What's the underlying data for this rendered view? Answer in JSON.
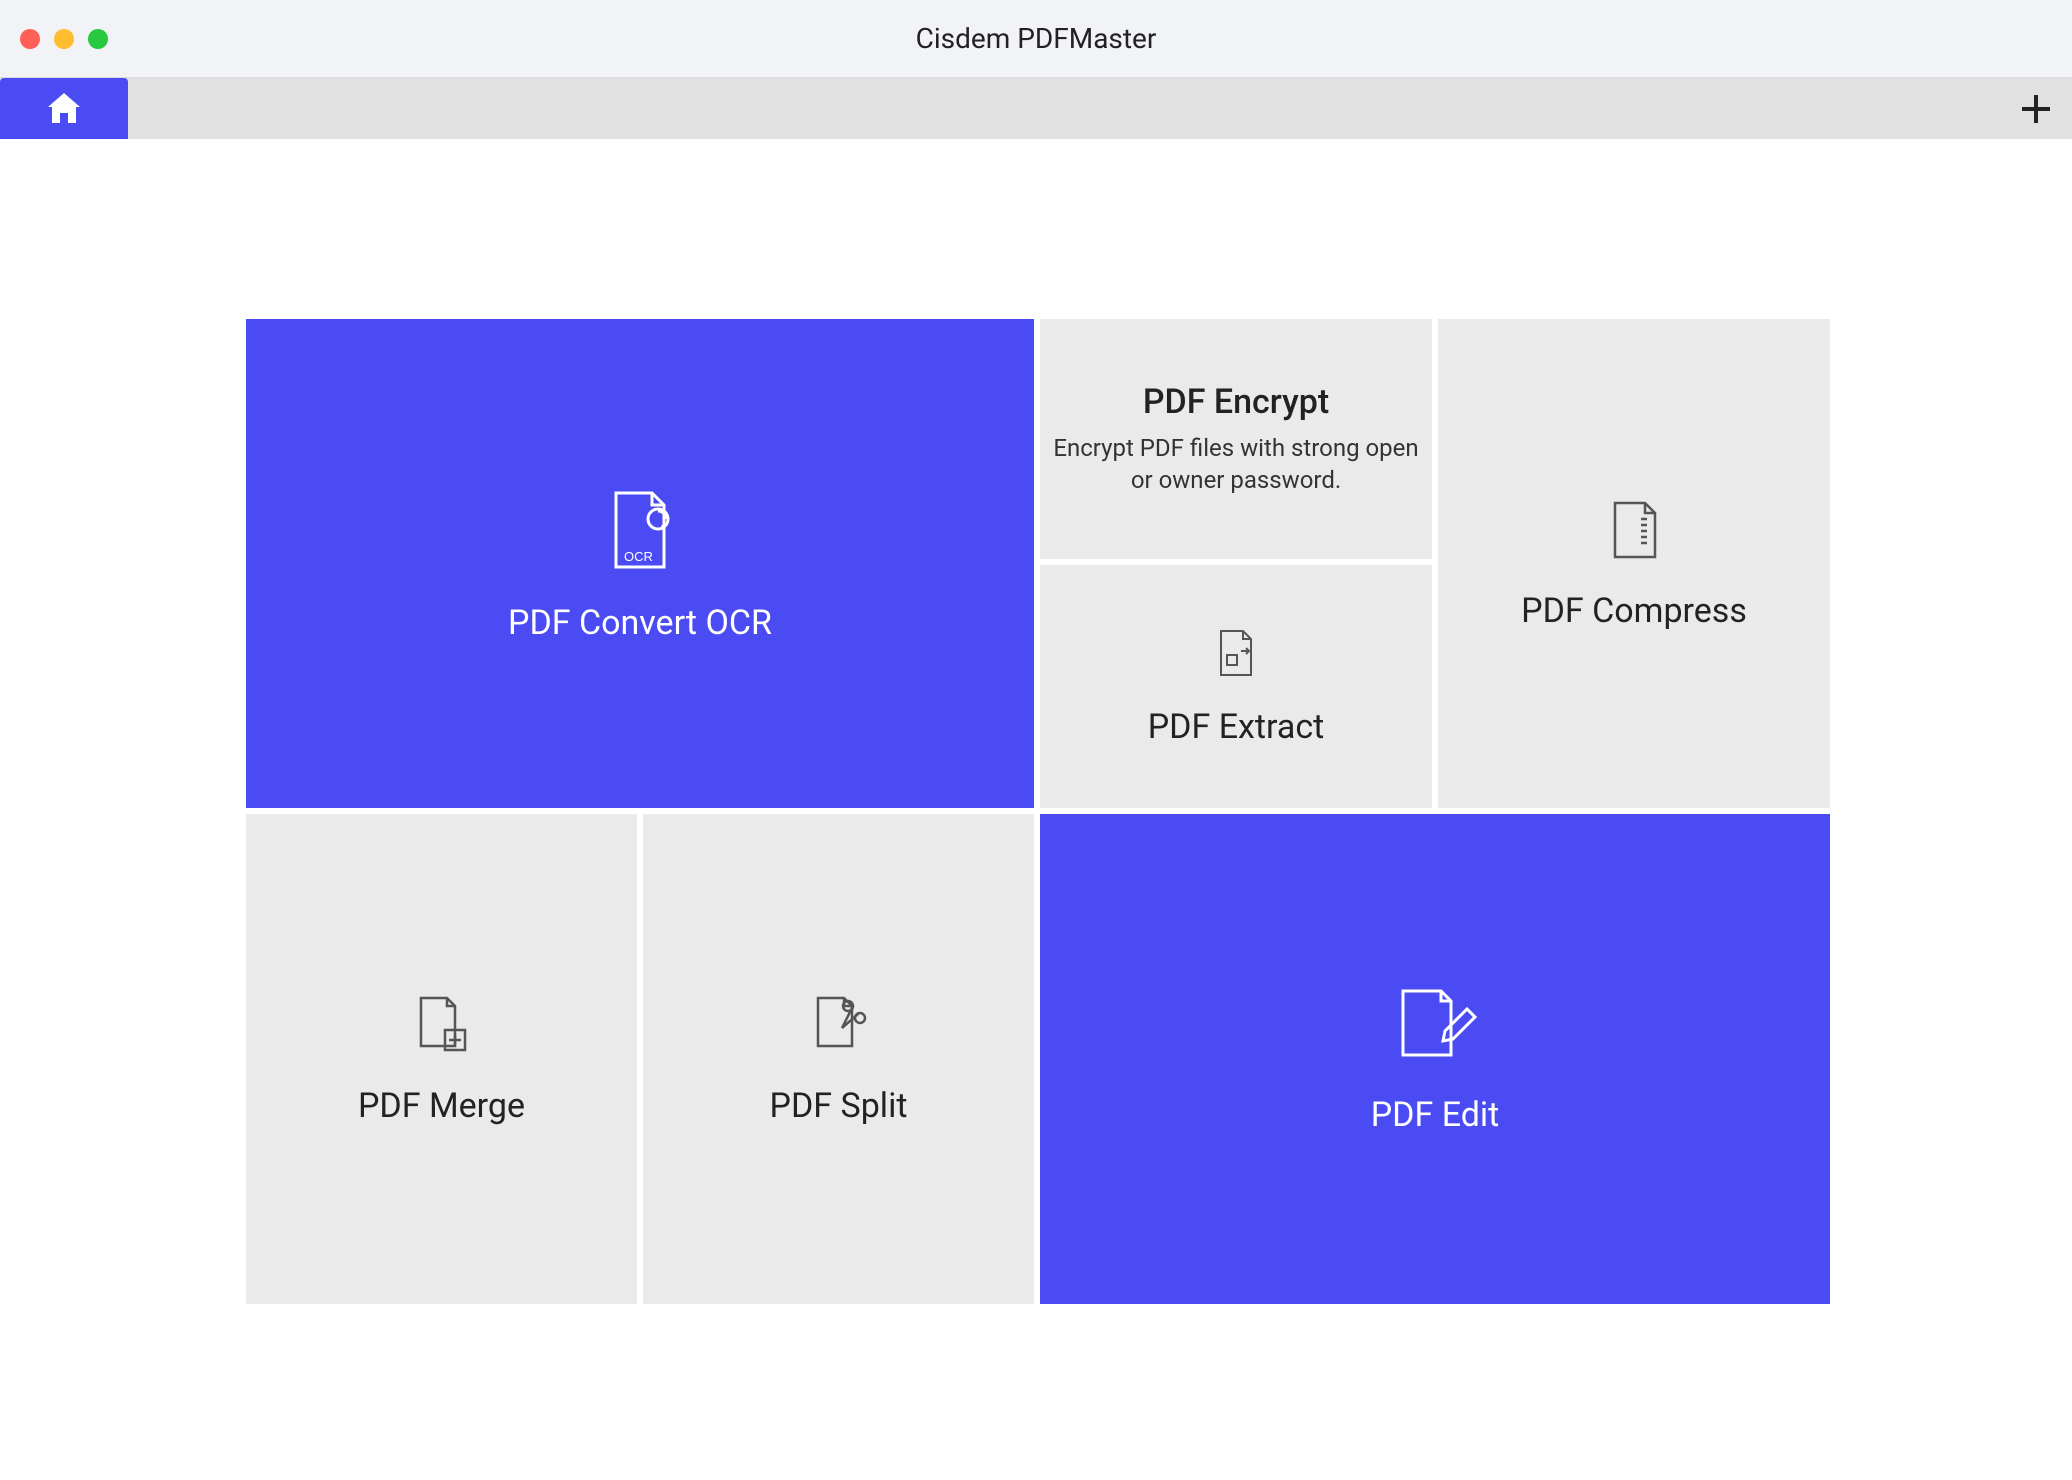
{
  "app": {
    "title": "Cisdem PDFMaster"
  },
  "colors": {
    "accent": "#4b4bf3",
    "tile_bg": "#eaeaea"
  },
  "tiles": {
    "convert": {
      "label": "PDF Convert OCR"
    },
    "encrypt": {
      "label": "PDF Encrypt",
      "sublabel": "Encrypt PDF files with strong open or owner password."
    },
    "extract": {
      "label": "PDF Extract"
    },
    "compress": {
      "label": "PDF Compress"
    },
    "merge": {
      "label": "PDF Merge"
    },
    "split": {
      "label": "PDF Split"
    },
    "edit": {
      "label": "PDF Edit"
    }
  }
}
